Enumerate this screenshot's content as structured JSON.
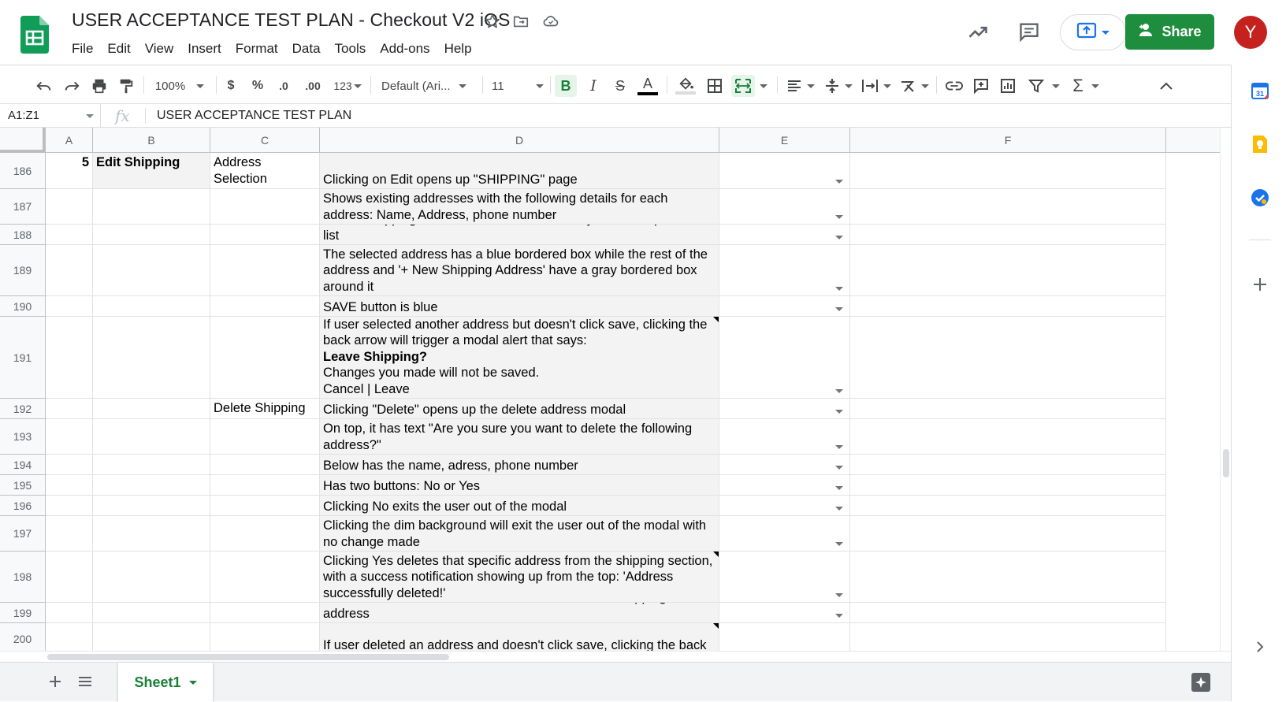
{
  "window": {
    "title": "USER ACCEPTANCE TEST PLAN - Checkout V2 iOS"
  },
  "menu": [
    "File",
    "Edit",
    "View",
    "Insert",
    "Format",
    "Data",
    "Tools",
    "Add-ons",
    "Help"
  ],
  "header": {
    "share_label": "Share",
    "avatar_letter": "Y",
    "share_color": "#1e8e3e",
    "avatar_color": "#c5221f"
  },
  "toolbar": {
    "zoom": "100%",
    "currency": "$",
    "percent": "%",
    "decrease_decimal": ".0",
    "increase_decimal": ".00",
    "more_formats": "123",
    "font": "Default (Ari...",
    "font_size": "11",
    "bold": "B",
    "italic": "I",
    "strikethrough": "S",
    "text_color": "A"
  },
  "formula_bar": {
    "name_box": "A1:Z1",
    "fx": "fx",
    "content": "USER ACCEPTANCE TEST PLAN"
  },
  "grid": {
    "columns": [
      "A",
      "B",
      "C",
      "D",
      "E",
      "F"
    ],
    "rows": [
      {
        "n": "186",
        "a": "5",
        "b": "Edit Shipping",
        "c": "Address Selection",
        "d": "Clicking on Edit opens up \"SHIPPING\" page"
      },
      {
        "n": "187",
        "a": "",
        "b": "",
        "c": "",
        "d": "Shows existing addresses with the following details for each address: Name, Address, phone number"
      },
      {
        "n": "188",
        "a": "",
        "b": "",
        "c": "",
        "d": "Default shipping address is selected and always on the top of the list"
      },
      {
        "n": "189",
        "a": "",
        "b": "",
        "c": "",
        "d": "The selected address has a blue bordered box while the rest of the address and '+ New Shipping Address' have a gray bordered box around it"
      },
      {
        "n": "190",
        "a": "",
        "b": "",
        "c": "",
        "d": "SAVE button is blue"
      },
      {
        "n": "191",
        "a": "",
        "b": "",
        "c": "",
        "d_lines": [
          "If user selected another address but doesn't click save, clicking the back arrow will trigger a modal alert that says:",
          "Leave Shipping?",
          "Changes you made will not be saved.",
          "Cancel | Leave"
        ]
      },
      {
        "n": "192",
        "a": "",
        "b": "",
        "c": "Delete Shipping",
        "d": "Clicking \"Delete\" opens up the delete address modal"
      },
      {
        "n": "193",
        "a": "",
        "b": "",
        "c": "",
        "d": "On top, it has text \"Are you sure you want to delete the following address?\""
      },
      {
        "n": "194",
        "a": "",
        "b": "",
        "c": "",
        "d": "Below has the name, adress, phone number"
      },
      {
        "n": "195",
        "a": "",
        "b": "",
        "c": "",
        "d": "Has two buttons: No or Yes"
      },
      {
        "n": "196",
        "a": "",
        "b": "",
        "c": "",
        "d": "Clicking No exits the user out of the modal"
      },
      {
        "n": "197",
        "a": "",
        "b": "",
        "c": "",
        "d": "Clicking the dim background will exit the user out of the modal with no change made"
      },
      {
        "n": "198",
        "a": "",
        "b": "",
        "c": "",
        "d": "Clicking Yes deletes that specific address from the shipping section, with a success notification showing up from the top: 'Address successfully deleted!'"
      },
      {
        "n": "199",
        "a": "",
        "b": "",
        "c": "",
        "d": "The next address on the list will now be the default shipping address"
      },
      {
        "n": "200",
        "a": "",
        "b": "",
        "c": "",
        "d": "If user deleted an address and doesn't click save, clicking the back"
      }
    ]
  },
  "sheets": {
    "active": "Sheet1"
  }
}
